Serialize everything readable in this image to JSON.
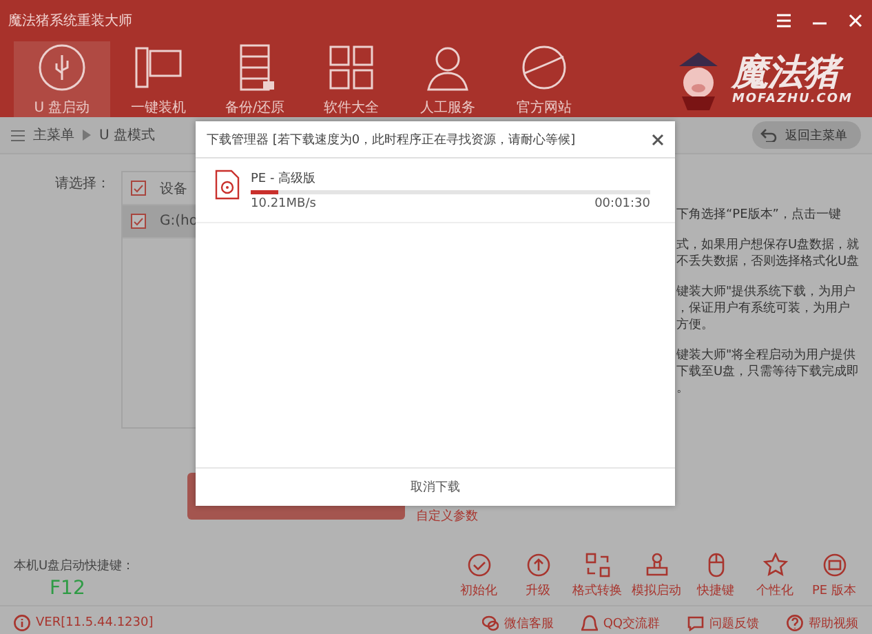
{
  "window": {
    "title": "魔法猪系统重装大师"
  },
  "nav": [
    {
      "label": "U 盘启动",
      "selected": true
    },
    {
      "label": "一键装机",
      "selected": false
    },
    {
      "label": "备份/还原",
      "selected": false
    },
    {
      "label": "软件大全",
      "selected": false
    },
    {
      "label": "人工服务",
      "selected": false
    },
    {
      "label": "官方网站",
      "selected": false
    }
  ],
  "logo": {
    "name": "魔法猪",
    "domain": "MOFAZHU.COM"
  },
  "breadcrumb": [
    "主菜单",
    "U 盘模式"
  ],
  "back_button": "返回主菜单",
  "select_label": "请选择：",
  "table": {
    "header": {
      "cell": "设备",
      "checked": true
    },
    "rows": [
      {
        "cell": "G:(ho",
        "checked": true,
        "selected": true
      }
    ]
  },
  "notes": [
    [
      "下角选择“PE版本”，点击一键"
    ],
    [
      "式，如果用户想保存U盘数据，就",
      "不丢失数据，否则选择格式化U盘"
    ],
    [
      "键装大师\"提供系统下载，为用户",
      "，保证用户有系统可装，为用户",
      "方便。"
    ],
    [
      "键装大师\"将全程启动为用户提供",
      "下载至U盘，只需等待下载完成即",
      "。"
    ]
  ],
  "custom_params_link": "自定义参数",
  "shortcut": {
    "label": "本机U盘启动快捷键：",
    "key": "F12"
  },
  "tools": [
    "初始化",
    "升级",
    "格式转换",
    "模拟启动",
    "快捷键",
    "个性化",
    "PE 版本"
  ],
  "status_bar": {
    "version": "VER[11.5.44.1230]",
    "links": [
      "微信客服",
      "QQ交流群",
      "问题反馈",
      "帮助视频"
    ]
  },
  "dialog": {
    "title": "下载管理器 [若下载速度为0，此时程序正在寻找资源，请耐心等候]",
    "items": [
      {
        "name": "PE - 高级版",
        "level": 0.07,
        "speed": "10.21MB/s",
        "time": "00:01:30"
      }
    ],
    "cancel": "取消下载"
  }
}
